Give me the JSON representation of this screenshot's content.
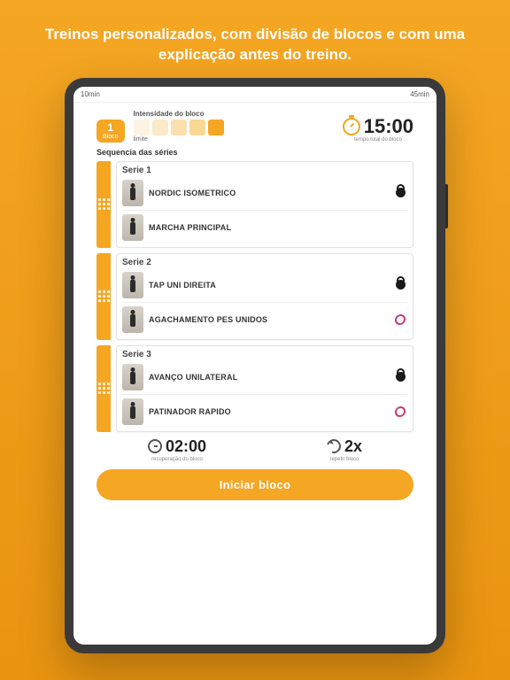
{
  "headline": "Treinos personalizados, com divisão de blocos e com uma explicação antes do treino.",
  "statusbar": {
    "left": "10min",
    "right": "45min"
  },
  "bloco": {
    "number": "1",
    "label": "Bloco"
  },
  "intensity": {
    "label": "Intensidade do bloco",
    "sublabel": "limite"
  },
  "timer": {
    "value": "15:00",
    "sublabel": "tempo total do bloco"
  },
  "sequence_label": "Sequencia das séries",
  "series": [
    {
      "title": "Serie 1",
      "exercises": [
        {
          "name": "NORDIC ISOMETRICO",
          "equipment": "kettlebell"
        },
        {
          "name": "MARCHA PRINCIPAL",
          "equipment": "none"
        }
      ]
    },
    {
      "title": "Serie 2",
      "exercises": [
        {
          "name": "TAP UNI DIREITA",
          "equipment": "kettlebell"
        },
        {
          "name": "AGACHAMENTO PES UNIDOS",
          "equipment": "band"
        }
      ]
    },
    {
      "title": "Serie 3",
      "exercises": [
        {
          "name": "AVANÇO UNILATERAL",
          "equipment": "kettlebell"
        },
        {
          "name": "PATINADOR RAPIDO",
          "equipment": "band"
        }
      ]
    }
  ],
  "recovery": {
    "value": "02:00",
    "label": "recuperação do bloco"
  },
  "repeat": {
    "value": "2x",
    "label": "repetir bloco"
  },
  "cta": "Iniciar bloco",
  "colors": {
    "accent": "#f5a623"
  }
}
